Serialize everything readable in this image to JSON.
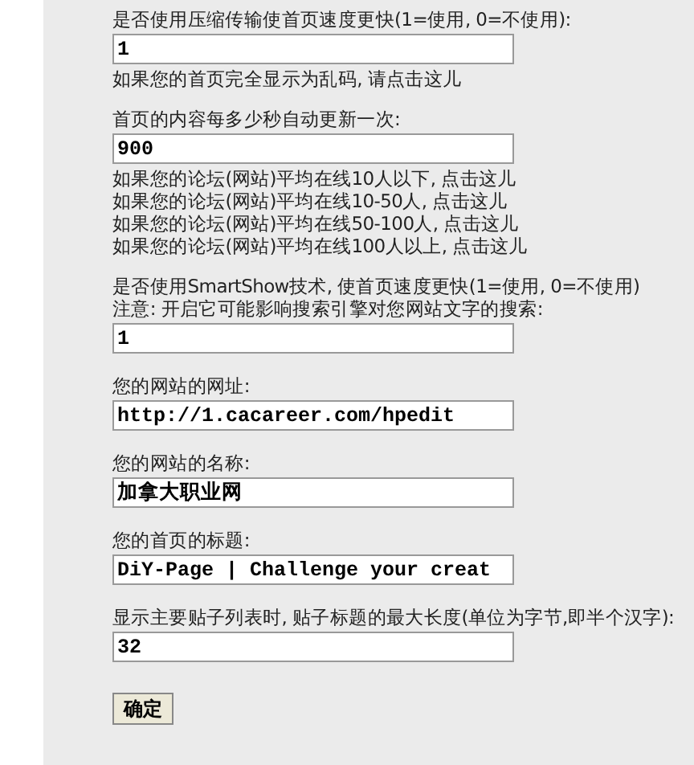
{
  "sections": [
    {
      "labels": [
        "是否使用压缩传输使首页速度更快(1=使用, 0=不使用):"
      ],
      "field": {
        "value": "1"
      },
      "notes": [
        "如果您的首页完全显示为乱码, 请点击这儿"
      ]
    },
    {
      "labels": [
        "首页的内容每多少秒自动更新一次:"
      ],
      "field": {
        "value": "900"
      },
      "notes": [
        "如果您的论坛(网站)平均在线10人以下, 点击这儿",
        "如果您的论坛(网站)平均在线10-50人, 点击这儿",
        "如果您的论坛(网站)平均在线50-100人, 点击这儿",
        "如果您的论坛(网站)平均在线100人以上, 点击这儿"
      ]
    },
    {
      "labels": [
        "是否使用SmartShow技术, 使首页速度更快(1=使用, 0=不使用)",
        "注意: 开启它可能影响搜索引擎对您网站文字的搜索:"
      ],
      "field": {
        "value": "1"
      }
    },
    {
      "labels": [
        "您的网站的网址:"
      ],
      "field": {
        "value": "http://1.cacareer.com/hpedit"
      }
    },
    {
      "labels": [
        "您的网站的名称:"
      ],
      "field": {
        "value": "加拿大职业网"
      }
    },
    {
      "labels": [
        "您的首页的标题:"
      ],
      "field": {
        "value": "DiY-Page | Challenge your creat"
      }
    },
    {
      "labels": [
        "显示主要贴子列表时, 贴子标题的最大长度(单位为字节,即半个汉字):"
      ],
      "field": {
        "value": "32"
      }
    }
  ],
  "submit": {
    "label": "确定"
  }
}
